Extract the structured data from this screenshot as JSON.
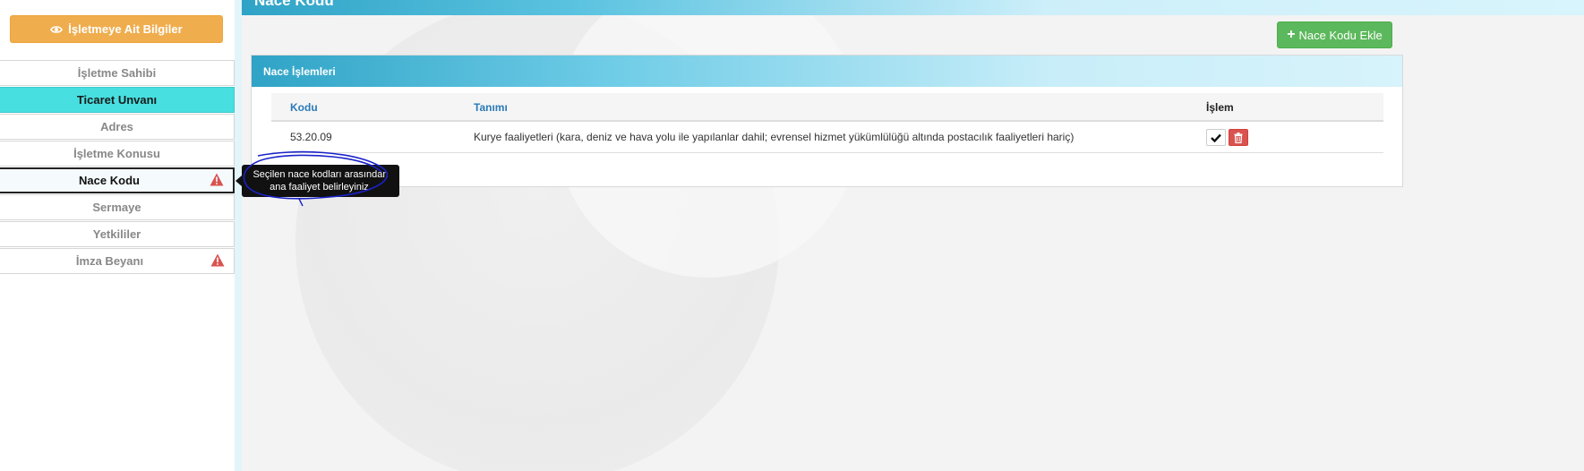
{
  "sidebar": {
    "info_button": "İşletmeye Ait Bilgiler",
    "items": [
      {
        "label": "İşletme Sahibi",
        "warning": false
      },
      {
        "label": "Ticaret Unvanı",
        "warning": false
      },
      {
        "label": "Adres",
        "warning": false
      },
      {
        "label": "İşletme Konusu",
        "warning": false
      },
      {
        "label": "Nace Kodu",
        "warning": true
      },
      {
        "label": "Sermaye",
        "warning": false
      },
      {
        "label": "Yetkililer",
        "warning": false
      },
      {
        "label": "İmza Beyanı",
        "warning": true
      }
    ]
  },
  "header": {
    "title": "Nace Kodu"
  },
  "toolbar": {
    "add_label": "Nace Kodu Ekle"
  },
  "panel": {
    "title": "Nace İşlemleri",
    "columns": {
      "code": "Kodu",
      "description": "Tanımı",
      "action": "İşlem"
    },
    "rows": [
      {
        "code": "53.20.09",
        "description": "Kurye faaliyetleri (kara, deniz ve hava yolu ile yapılanlar dahil; evrensel hizmet yükümlülüğü altında postacılık faaliyetleri hariç)"
      }
    ]
  },
  "tooltip": {
    "line1": "Seçilen nace kodları arasından",
    "line2": "ana faaliyet belirleyiniz."
  },
  "colors": {
    "warning_orange": "#f0ad4e",
    "success_green": "#5cb85c",
    "danger_red": "#d9534f",
    "active_teal": "#47dfe0",
    "header_blue": "#2fa3c6"
  }
}
